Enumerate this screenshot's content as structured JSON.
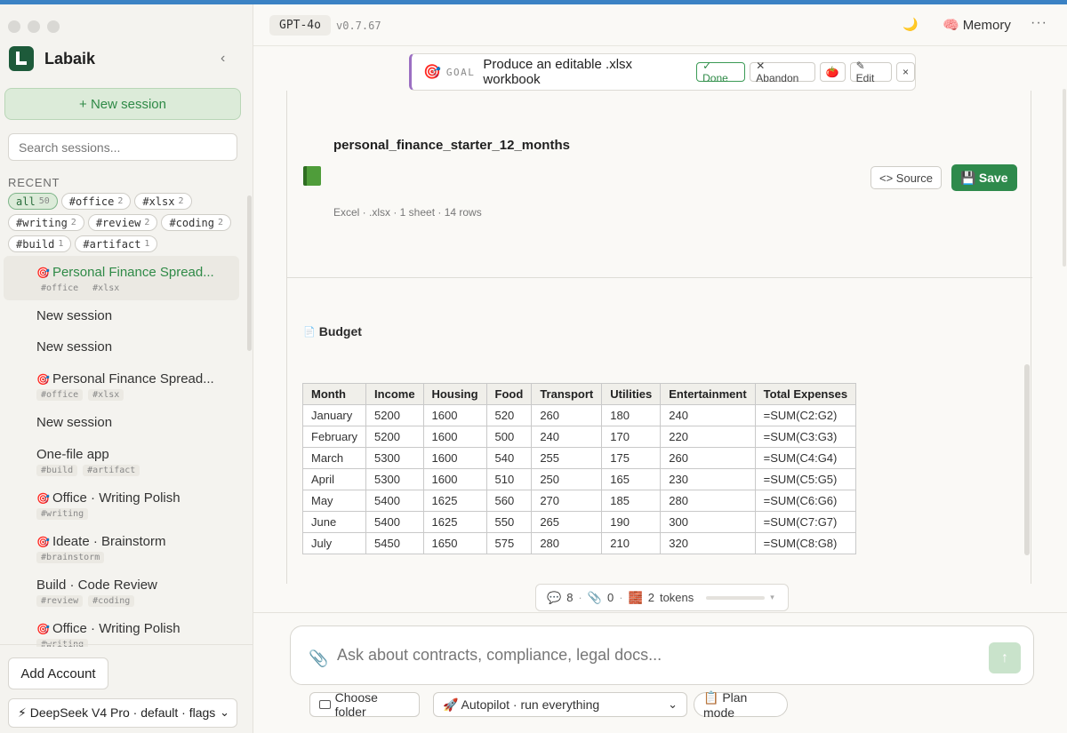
{
  "sidebar": {
    "brand": "Labaik",
    "collapse_icon": "‹",
    "new_session": "+ New session",
    "search_placeholder": "Search sessions...",
    "recent_label": "RECENT",
    "tags": [
      {
        "name": "all",
        "count": "50",
        "active": true
      },
      {
        "name": "#office",
        "count": "2"
      },
      {
        "name": "#xlsx",
        "count": "2"
      },
      {
        "name": "#writing",
        "count": "2"
      },
      {
        "name": "#review",
        "count": "2"
      },
      {
        "name": "#coding",
        "count": "2"
      },
      {
        "name": "#build",
        "count": "1"
      },
      {
        "name": "#artifact",
        "count": "1"
      }
    ],
    "sessions": [
      {
        "title": "Personal Finance Spread...",
        "goal": true,
        "tags": [
          "#office",
          "#xlsx"
        ],
        "active": true
      },
      {
        "title": "New session",
        "goal": false,
        "tags": []
      },
      {
        "title": "New session",
        "goal": false,
        "tags": []
      },
      {
        "title": "Personal Finance Spread...",
        "goal": true,
        "tags": [
          "#office",
          "#xlsx"
        ]
      },
      {
        "title": "New session",
        "goal": false,
        "tags": []
      },
      {
        "title": "One-file app",
        "goal": false,
        "tags": [
          "#build",
          "#artifact"
        ]
      },
      {
        "title": "Office · Writing Polish",
        "goal": true,
        "tags": [
          "#writing"
        ]
      },
      {
        "title": "Ideate · Brainstorm",
        "goal": true,
        "tags": [
          "#brainstorm"
        ]
      },
      {
        "title": "Build · Code Review",
        "goal": false,
        "tags": [
          "#review",
          "#coding"
        ]
      },
      {
        "title": "Office · Writing Polish",
        "goal": true,
        "tags": [
          "#writing"
        ]
      }
    ],
    "add_account": "Add Account",
    "model_select": "⚡ DeepSeek V4 Pro · default · flags"
  },
  "topbar": {
    "model": "GPT-4o",
    "version": "v0.7.67",
    "theme_icon": "🌙",
    "memory_icon": "🧠",
    "memory_label": "Memory",
    "more_icon": "···"
  },
  "goal": {
    "icon": "🎯",
    "label": "GOAL",
    "text": "Produce an editable .xlsx workbook",
    "done": "✓ Done",
    "abandon": "✕ Abandon",
    "tomato": "🍅",
    "edit": "✎ Edit",
    "close": "×"
  },
  "file": {
    "title": "personal_finance_starter_12_months",
    "meta": "Excel · .xlsx · 1 sheet · 14 rows",
    "source": "<> Source",
    "save_icon": "💾",
    "save": "Save"
  },
  "sheet": {
    "icon": "📄",
    "name": "Budget",
    "columns": [
      "Month",
      "Income",
      "Housing",
      "Food",
      "Transport",
      "Utilities",
      "Entertainment",
      "Total Expenses"
    ],
    "rows": [
      [
        "January",
        "5200",
        "1600",
        "520",
        "260",
        "180",
        "240",
        "=SUM(C2:G2)"
      ],
      [
        "February",
        "5200",
        "1600",
        "500",
        "240",
        "170",
        "220",
        "=SUM(C3:G3)"
      ],
      [
        "March",
        "5300",
        "1600",
        "540",
        "255",
        "175",
        "260",
        "=SUM(C4:G4)"
      ],
      [
        "April",
        "5300",
        "1600",
        "510",
        "250",
        "165",
        "230",
        "=SUM(C5:G5)"
      ],
      [
        "May",
        "5400",
        "1625",
        "560",
        "270",
        "185",
        "280",
        "=SUM(C6:G6)"
      ],
      [
        "June",
        "5400",
        "1625",
        "550",
        "265",
        "190",
        "300",
        "=SUM(C7:G7)"
      ],
      [
        "July",
        "5450",
        "1650",
        "575",
        "280",
        "210",
        "320",
        "=SUM(C8:G8)"
      ]
    ]
  },
  "status": {
    "messages_icon": "💬",
    "messages": "8",
    "attachments_icon": "📎",
    "attachments": "0",
    "tokens_icon": "🧱",
    "tokens": "2",
    "tokens_label": "tokens",
    "menu_icon": "▾"
  },
  "composer": {
    "attach_icon": "📎",
    "placeholder": "Ask about contracts, compliance, legal docs...",
    "send_icon": "↑",
    "choose_folder": "Choose folder",
    "autopilot": "🚀 Autopilot · run everything",
    "plan_mode": "📋 Plan mode"
  }
}
